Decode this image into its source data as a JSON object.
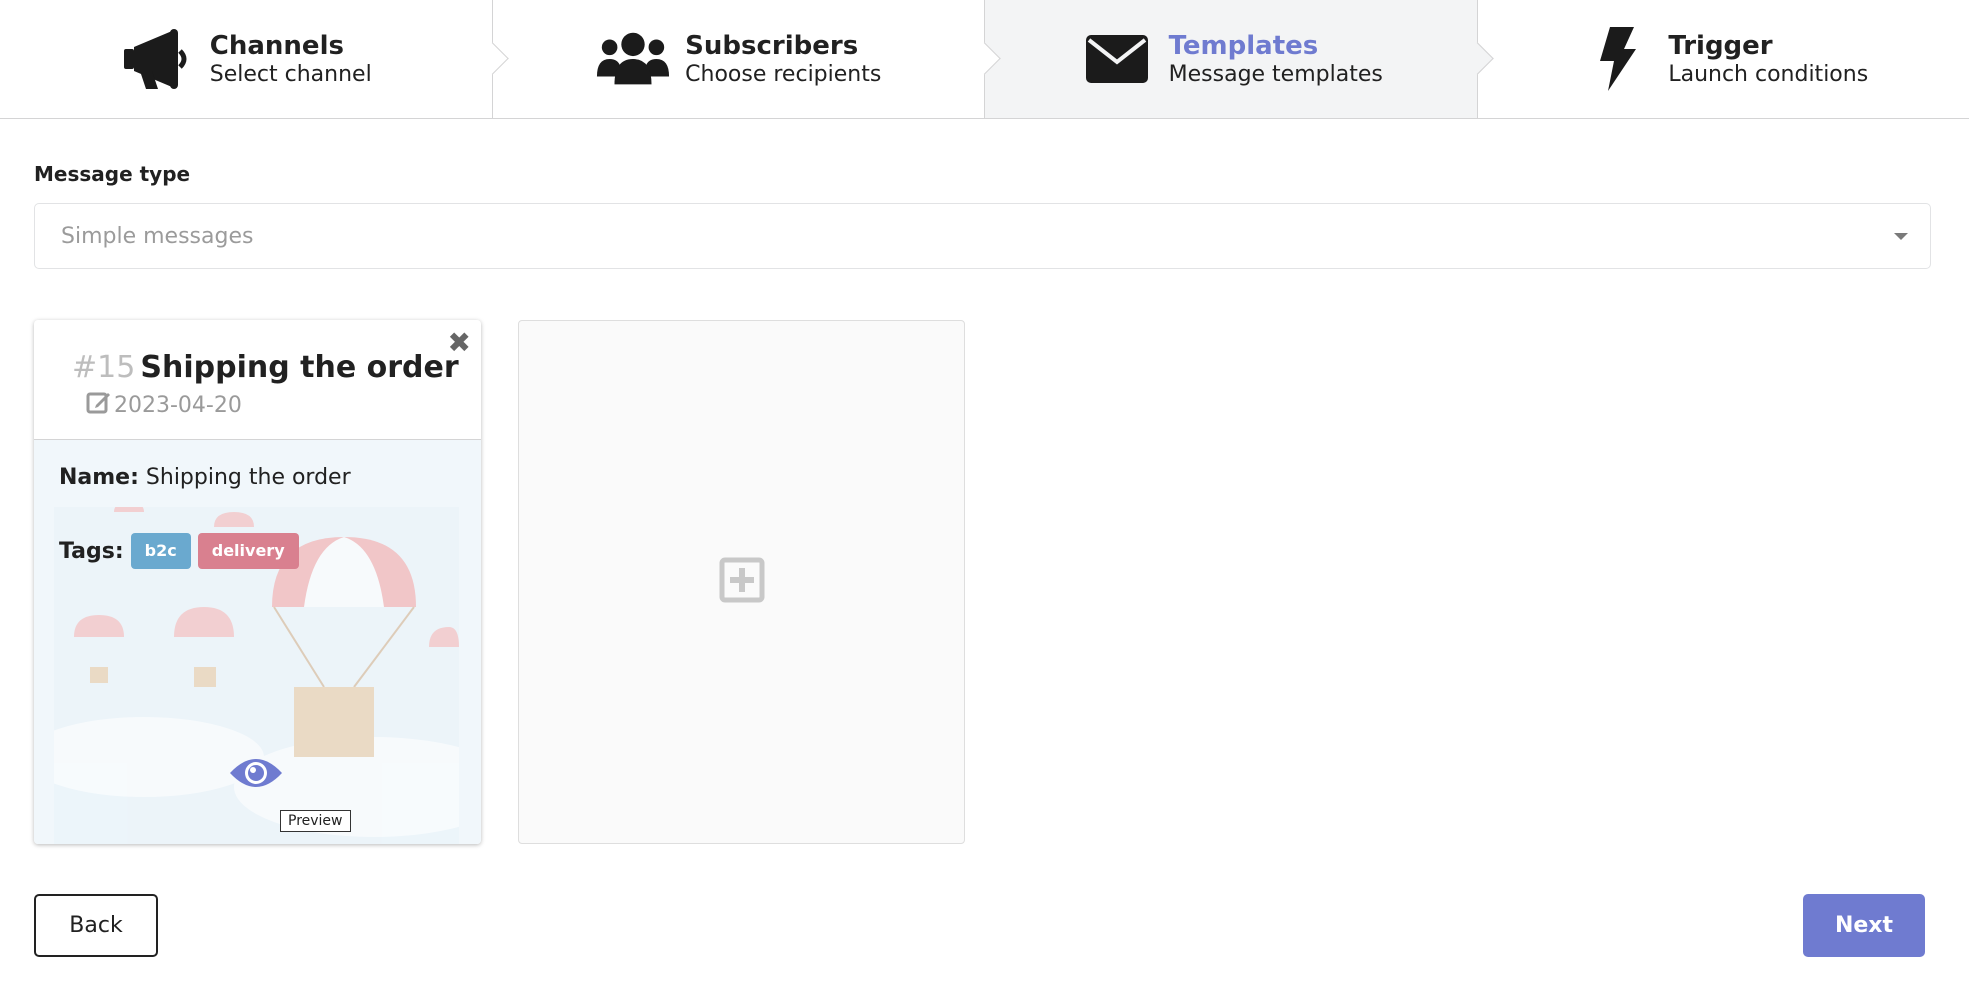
{
  "steps": [
    {
      "title": "Channels",
      "description": "Select channel",
      "icon": "megaphone-icon",
      "active": false
    },
    {
      "title": "Subscribers",
      "description": "Choose recipients",
      "icon": "users-icon",
      "active": false
    },
    {
      "title": "Templates",
      "description": "Message templates",
      "icon": "envelope-icon",
      "active": true
    },
    {
      "title": "Trigger",
      "description": "Launch conditions",
      "icon": "bolt-icon",
      "active": false
    }
  ],
  "form": {
    "message_type_label": "Message type",
    "message_type_value": "Simple messages"
  },
  "template_card": {
    "number": "#15",
    "title": "Shipping the order",
    "date": "2023-04-20",
    "name_label": "Name:",
    "name_value": "Shipping the order",
    "tags_label": "Tags:",
    "tags": [
      "b2c",
      "delivery"
    ],
    "preview_tooltip": "Preview"
  },
  "buttons": {
    "back": "Back",
    "next": "Next"
  },
  "colors": {
    "accent": "#6f7bd0",
    "tag_b2c": "#6aa9cf",
    "tag_delivery": "#d9808f",
    "active_step_bg": "#f3f4f5"
  }
}
